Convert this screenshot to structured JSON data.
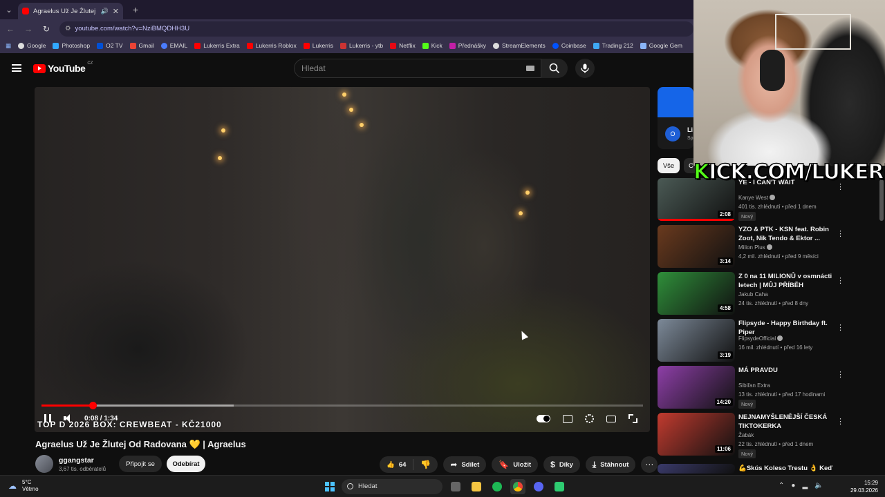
{
  "browser": {
    "tab_title": "Agraelus Už Je Žlutej Od R...",
    "url": "youtube.com/watch?v=NziBMQDHH3U",
    "bookmarks": [
      "Google",
      "Photoshop",
      "O2 TV",
      "Gmail",
      "EMAIL",
      "Lukerris Extra",
      "Lukerris Roblox",
      "Lukerris",
      "Lukerris - ytb",
      "Netflix",
      "Kick",
      "Přednášky",
      "StreamElements",
      "Coinbase",
      "Trading 212",
      "Google Gem"
    ]
  },
  "youtube": {
    "logo_text": "YouTube",
    "logo_region": "CZ",
    "search_placeholder": "Hledat"
  },
  "player": {
    "overlay_text": "TOP D 2026 BOX: CREWBEAT   - KČ21000",
    "time": "0:08 / 1:34",
    "progress": 0.085,
    "buffered": 0.32
  },
  "video": {
    "title": "Agraelus Už Je Žlutej Od Radovana 💛 | Agraelus",
    "channel": "ggangstar",
    "subscribers": "3,67 tis. odběratelů",
    "join_label": "Připojit se",
    "subscribe_label": "Odebírat",
    "likes": "64",
    "share": "Sdílet",
    "save": "Uložit",
    "thanks": "Díky",
    "download": "Stáhnout"
  },
  "sidebar": {
    "ad_title": "Li",
    "ad_sub": "Sp",
    "ad_logo": "O",
    "chip_all": "Vše",
    "chip_next": "C",
    "kick_overlay": "KICK.COM/LUKERRIS",
    "recs": [
      {
        "title": "YE - I CAN'T WAIT",
        "channel": "Kanye West",
        "verified": true,
        "meta": "401 tis. zhlédnutí • před 1 dnem",
        "badge": "Nový",
        "duration": "2:08",
        "color": "#4b5a55"
      },
      {
        "title": "YZO & PTK - KSN feat. Robin Zoot, Nik Tendo & Ektor ...",
        "channel": "Milion Plus",
        "verified": true,
        "meta": "4,2 mil. zhlédnutí • před 9 měsíci",
        "badge": "",
        "duration": "3:14",
        "color": "#6a3a1e"
      },
      {
        "title": "Z 0 na 11 MILIONŮ v osmnácti letech | MŮJ PŘÍBĚH",
        "channel": "Jakub Caha",
        "verified": false,
        "meta": "24 tis. zhlédnutí • před 8 dny",
        "badge": "",
        "duration": "4:58",
        "color": "#2f8f3a"
      },
      {
        "title": "Flipsyde - Happy Birthday ft. Piper",
        "channel": "FlipsydeOfficial",
        "verified": true,
        "meta": "16 mil. zhlédnutí • před 16 lety",
        "badge": "",
        "duration": "3:19",
        "color": "#7d8a99"
      },
      {
        "title": "MÁ PRAVDU",
        "channel": "Sibiřan Extra",
        "verified": false,
        "meta": "13 tis. zhlédnutí • před 17 hodinami",
        "badge": "Nový",
        "duration": "14:20",
        "color": "#8e3fa8"
      },
      {
        "title": "NEJNAMYŠLENĚJŠÍ ČESKÁ TIKTOKERKA",
        "channel": "Žabák",
        "verified": false,
        "meta": "22 tis. zhlédnutí • před 1 dnem",
        "badge": "Nový",
        "duration": "11:06",
        "color": "#c23b2f"
      },
      {
        "title": "💪Skús Koleso Trestu 👌 Keď",
        "channel": "",
        "verified": false,
        "meta": "",
        "badge": "",
        "duration": "",
        "color": "#3a3a6a"
      }
    ]
  },
  "taskbar": {
    "temp": "5°C",
    "weather": "Větrno",
    "search": "Hledat",
    "time": "15:29",
    "date": "29.03.2026"
  }
}
